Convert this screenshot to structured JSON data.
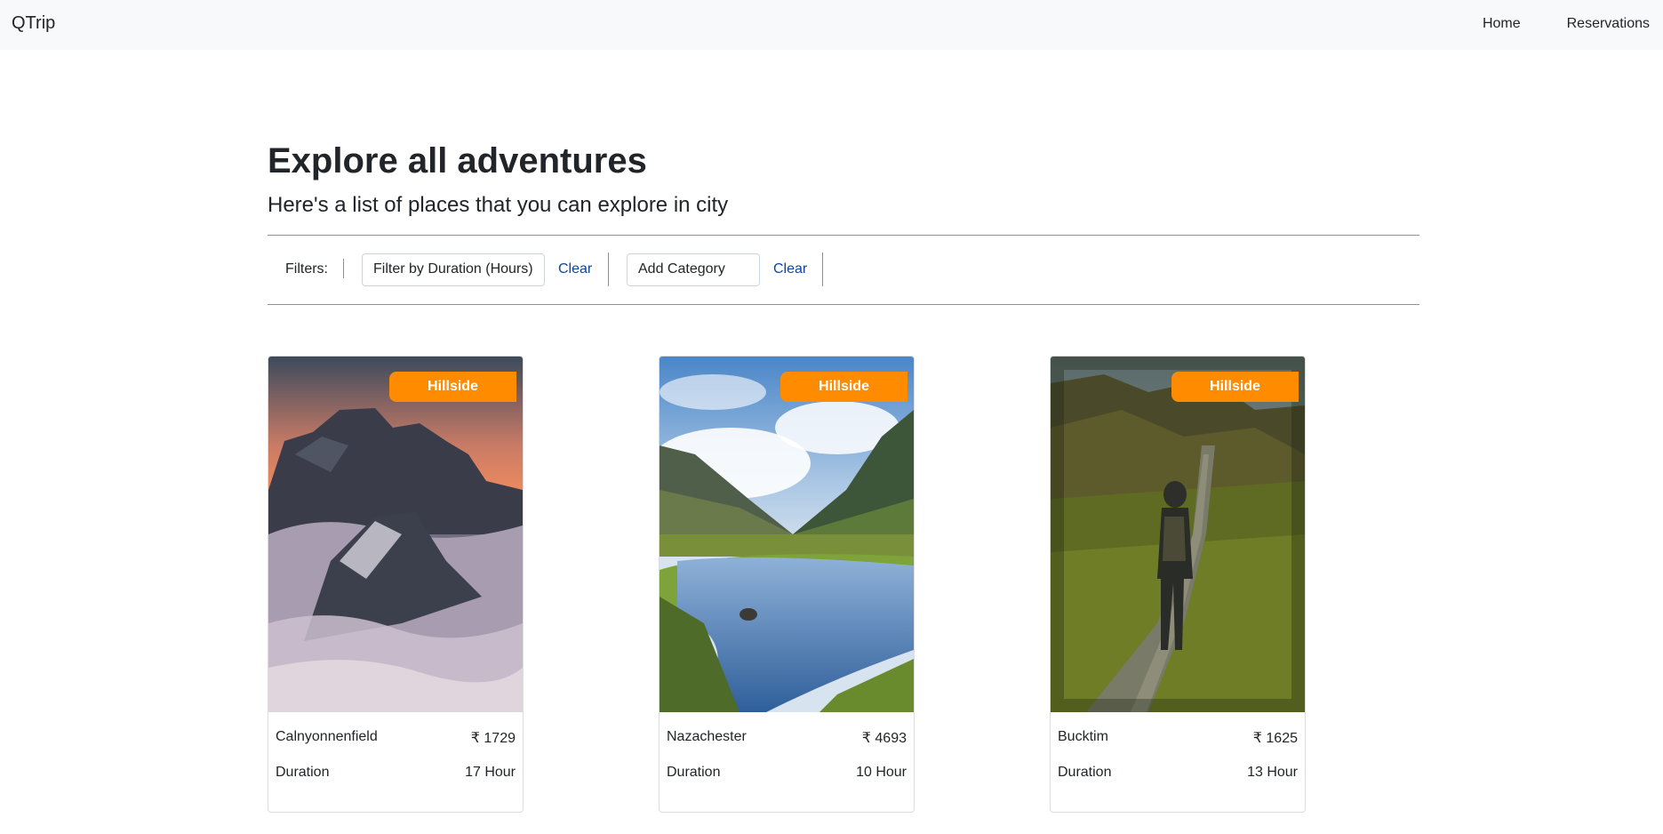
{
  "navbar": {
    "brand": "QTrip",
    "links": [
      {
        "label": "Home"
      },
      {
        "label": "Reservations"
      }
    ]
  },
  "header": {
    "title": "Explore all adventures",
    "subtitle": "Here's a list of places that you can explore in city"
  },
  "filters": {
    "label": "Filters:",
    "duration_select": "Filter by Duration (Hours)",
    "duration_clear": "Clear",
    "category_select": "Add Category",
    "category_clear": "Clear"
  },
  "adventures": [
    {
      "category": "Hillside",
      "name": "Calnyonnenfield",
      "price": "₹ 1729",
      "duration_label": "Duration",
      "duration": "17 Hour"
    },
    {
      "category": "Hillside",
      "name": "Nazachester",
      "price": "₹ 4693",
      "duration_label": "Duration",
      "duration": "10 Hour"
    },
    {
      "category": "Hillside",
      "name": "Bucktim",
      "price": "₹ 1625",
      "duration_label": "Duration",
      "duration": "13 Hour"
    }
  ],
  "colors": {
    "banner": "#ff8c00",
    "link": "#0d47a1",
    "navbar_bg": "#f8f9fa"
  }
}
